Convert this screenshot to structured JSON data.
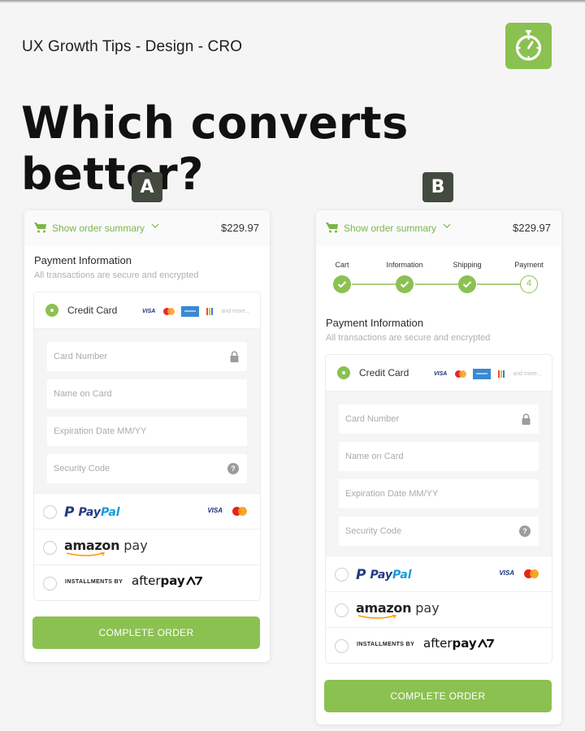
{
  "header": {
    "brand": "UX Growth Tips - Design - CRO",
    "logo_icon": "stopwatch-icon",
    "headline": "Which converts better?"
  },
  "colors": {
    "accent": "#8bc151",
    "badge": "#434a40",
    "background": "#f5f5f5"
  },
  "variants": {
    "a": {
      "badge": "A",
      "order_summary": {
        "label": "Show order summary",
        "total": "$229.97"
      },
      "payment": {
        "title": "Payment Information",
        "subtitle": "All transactions are secure and encrypted",
        "credit_card": {
          "label": "Credit Card",
          "selected": true,
          "brands": [
            "VISA",
            "Mastercard",
            "American Express",
            "Discover"
          ],
          "more": "and more..."
        },
        "fields": [
          {
            "placeholder": "Card Number",
            "value": "",
            "icon": "lock-icon"
          },
          {
            "placeholder": "Name on Card",
            "value": ""
          },
          {
            "placeholder": "Expiration Date MM/YY",
            "value": ""
          },
          {
            "placeholder": "Security Code",
            "value": "",
            "icon": "help-icon"
          }
        ],
        "alternatives": [
          {
            "name": "PayPal",
            "logo_a": "Pay",
            "logo_b": "Pal",
            "extra": "VISA"
          },
          {
            "name": "amazon pay",
            "logo_a": "amazon",
            "logo_b": " pay"
          },
          {
            "name": "Afterpay",
            "prefix": "INSTALLMENTS BY",
            "logo_a": "after",
            "logo_b": "pay"
          }
        ]
      },
      "cta": "COMPLETE ORDER"
    },
    "b": {
      "badge": "B",
      "order_summary": {
        "label": "Show order summary",
        "total": "$229.97"
      },
      "progress": {
        "steps": [
          {
            "label": "Cart",
            "status": "done"
          },
          {
            "label": "Information",
            "status": "done"
          },
          {
            "label": "Shipping",
            "status": "done"
          },
          {
            "label": "Payment",
            "status": "current",
            "number": "4"
          }
        ],
        "current_step": 4,
        "total_steps": 4
      },
      "payment": {
        "title": "Payment Information",
        "subtitle": "All transactions are secure and encrypted",
        "credit_card": {
          "label": "Credit Card",
          "selected": true,
          "brands": [
            "VISA",
            "Mastercard",
            "American Express",
            "Discover"
          ],
          "more": "and more..."
        },
        "fields": [
          {
            "placeholder": "Card Number",
            "value": "",
            "icon": "lock-icon"
          },
          {
            "placeholder": "Name on Card",
            "value": ""
          },
          {
            "placeholder": "Expiration Date MM/YY",
            "value": ""
          },
          {
            "placeholder": "Security Code",
            "value": "",
            "icon": "help-icon"
          }
        ],
        "alternatives": [
          {
            "name": "PayPal",
            "logo_a": "Pay",
            "logo_b": "Pal",
            "extra": "VISA"
          },
          {
            "name": "amazon pay",
            "logo_a": "amazon",
            "logo_b": " pay"
          },
          {
            "name": "Afterpay",
            "prefix": "INSTALLMENTS BY",
            "logo_a": "after",
            "logo_b": "pay"
          }
        ]
      },
      "cta": "COMPLETE ORDER"
    }
  }
}
